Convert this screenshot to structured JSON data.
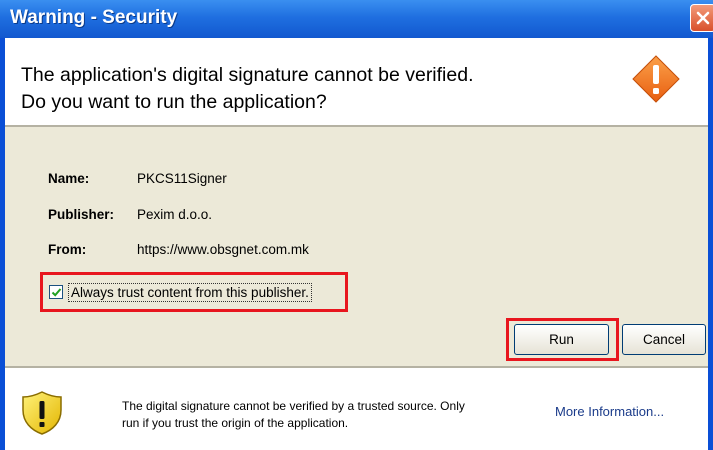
{
  "window": {
    "title": "Warning - Security"
  },
  "header": {
    "line1": "The application's digital signature cannot be verified.",
    "line2": "Do you want to run the application?"
  },
  "details": {
    "name_label": "Name:",
    "name_value": "PKCS11Signer",
    "publisher_label": "Publisher:",
    "publisher_value": "Pexim d.o.o.",
    "from_label": "From:",
    "from_value": "https://www.obsgnet.com.mk"
  },
  "trust_checkbox": {
    "label": "Always trust content from this publisher.",
    "checked": true
  },
  "buttons": {
    "run": "Run",
    "cancel": "Cancel"
  },
  "footer": {
    "line1": "The digital signature cannot be verified by a trusted source.  Only",
    "line2": "run if you trust the origin of the application.",
    "more_info": "More Information..."
  },
  "colors": {
    "titlebar": "#1f6fe0",
    "highlight": "#e8161e",
    "dialog_bg": "#ece9d8",
    "warning_orange": "#f47d20"
  },
  "icons": {
    "close": "close-icon",
    "warning": "warning-diamond-icon",
    "shield": "shield-warning-icon",
    "check": "check-icon"
  }
}
